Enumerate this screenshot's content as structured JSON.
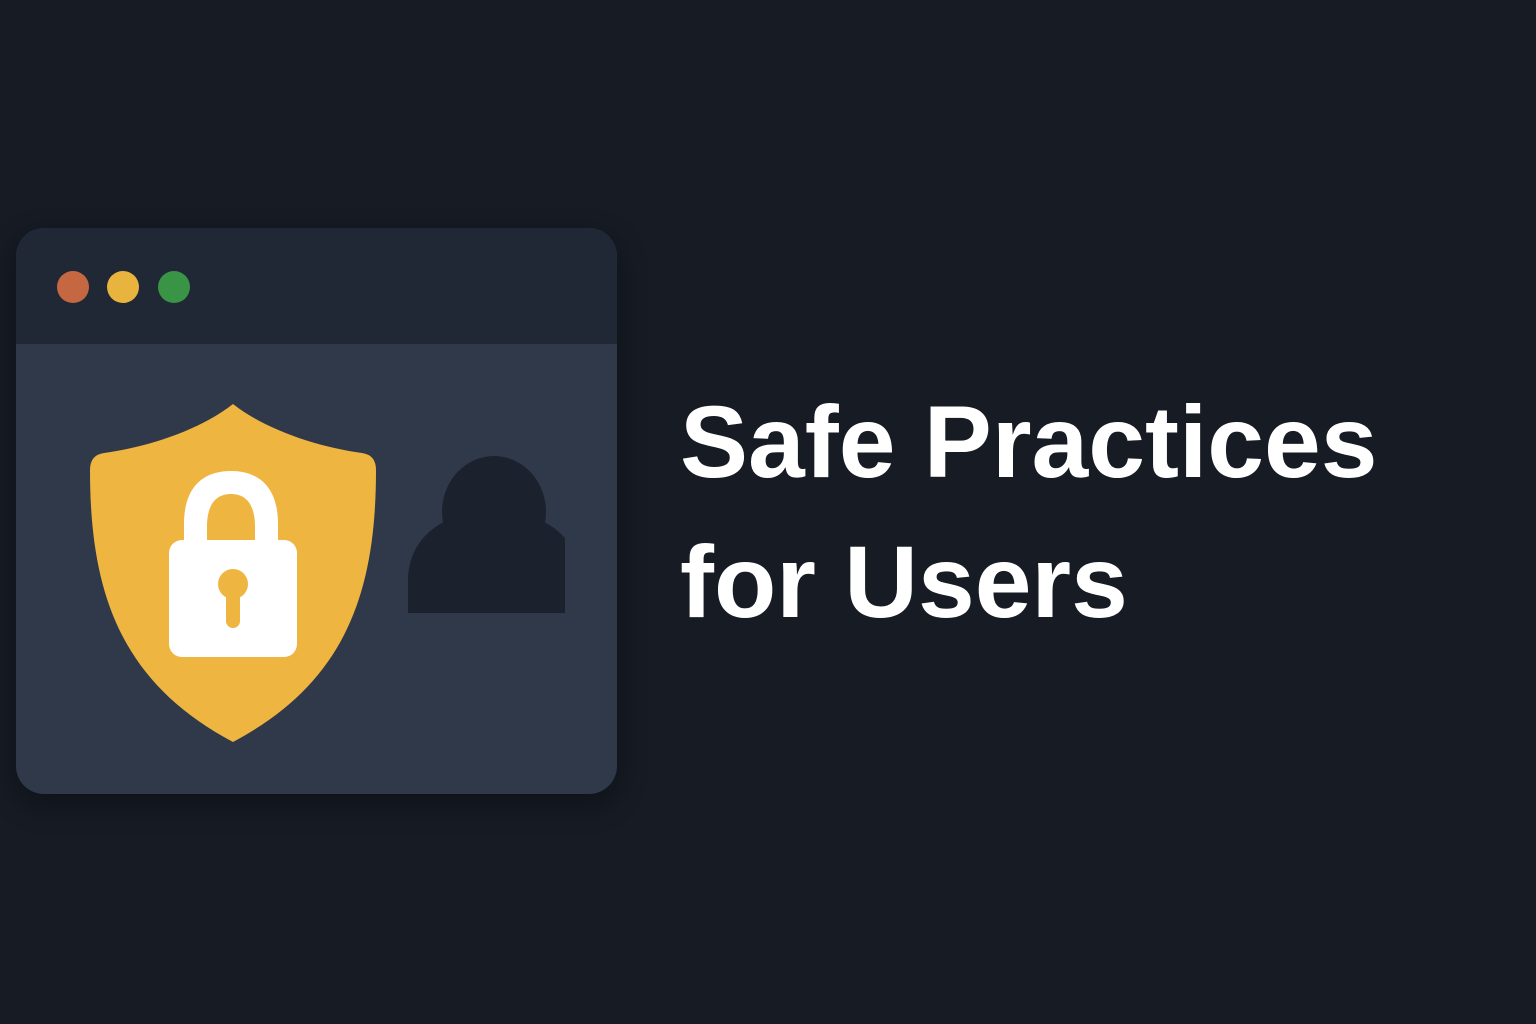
{
  "headline": {
    "line1": "Safe Practices",
    "line2": "for Users"
  },
  "window": {
    "controls": [
      {
        "name": "close",
        "color": "#c56842"
      },
      {
        "name": "minimize",
        "color": "#e8b43d"
      },
      {
        "name": "maximize",
        "color": "#3a9445"
      }
    ]
  },
  "icons": {
    "shield": {
      "name": "shield-icon",
      "color": "#efb541"
    },
    "lock": {
      "name": "padlock-icon",
      "color": "#ffffff"
    },
    "keyhole": {
      "name": "keyhole-icon",
      "color": "#efb541"
    },
    "user": {
      "name": "user-icon",
      "color": "#1b212d"
    }
  },
  "colors": {
    "background": "#161b24",
    "window_body": "#303949",
    "title_bar": "#202836",
    "text": "#ffffff"
  }
}
